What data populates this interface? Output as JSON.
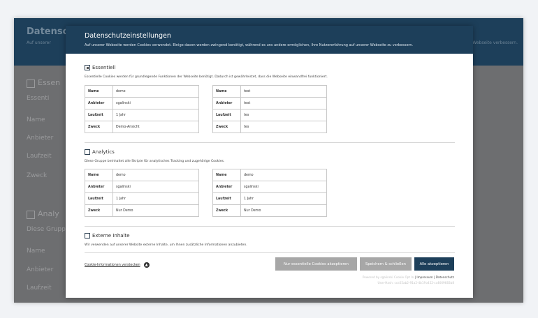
{
  "background": {
    "title": "Datensc",
    "line": "Auf unserer",
    "line_right": "e Webseite verbessern.",
    "side_labels": [
      "Essen",
      "Essenti",
      "Name",
      "Anbieter",
      "Laufzeit",
      "Zweck",
      "Analy",
      "Diese Grupp",
      "Name",
      "Anbieter",
      "Laufzeit"
    ]
  },
  "modal": {
    "title": "Datenschutzeinstellungen",
    "subtitle": "Auf unserer Webseite werden Cookies verwendet. Einige davon werden zwingend benötigt, während es uns andere ermöglichen, Ihre Nutzererfahrung auf unserer Webseite zu verbessern."
  },
  "sections": {
    "essential": {
      "label": "Essentiell",
      "description": "Essentielle Cookies werden für grundlegende Funktionen der Webseite benötigt. Dadurch ist gewährleistet, dass die Webseite einwandfrei funktioniert.",
      "tables": [
        {
          "rows": [
            [
              "Name",
              "demo"
            ],
            [
              "Anbieter",
              "sgalinski"
            ],
            [
              "Laufzeit",
              "1 Jahr"
            ],
            [
              "Zweck",
              "Demo-Ansicht"
            ]
          ]
        },
        {
          "rows": [
            [
              "Name",
              "test"
            ],
            [
              "Anbieter",
              "test"
            ],
            [
              "Laufzeit",
              "tes"
            ],
            [
              "Zweck",
              "tes"
            ]
          ]
        }
      ]
    },
    "analytics": {
      "label": "Analytics",
      "description": "Diese Gruppe beinhaltet alle Skripte für analytisches Tracking und zugehörige Cookies.",
      "tables": [
        {
          "rows": [
            [
              "Name",
              "demo"
            ],
            [
              "Anbieter",
              "sgalinski"
            ],
            [
              "Laufzeit",
              "1 Jahr"
            ],
            [
              "Zweck",
              "Nur Demo"
            ]
          ]
        },
        {
          "rows": [
            [
              "Name",
              "demo"
            ],
            [
              "Anbieter",
              "sgalinski"
            ],
            [
              "Laufzeit",
              "1 Jahr"
            ],
            [
              "Zweck",
              "Nur Demo"
            ]
          ]
        }
      ]
    },
    "external": {
      "label": "Externe Inhalte",
      "description": "Wir verwenden auf unserer Website externe Inhalte, um Ihnen zusätzliche Informationen anzubieten."
    }
  },
  "footer": {
    "hide_link": "Cookie-Informationen verstecken",
    "buttons": {
      "essential_only": "Nur essentielle Cookies akzeptieren",
      "save_close": "Speichern & schließen",
      "accept_all": "Alle akzeptieren"
    },
    "powered_by": "Powered by sgalinski Cookie Opt In",
    "sep": " | ",
    "impressum": "Impressum",
    "datenschutz": "Datenschutz",
    "user_hash": "User-Hash: cce25ab2-91a2-4b1f-b452-cc4669683b8"
  }
}
